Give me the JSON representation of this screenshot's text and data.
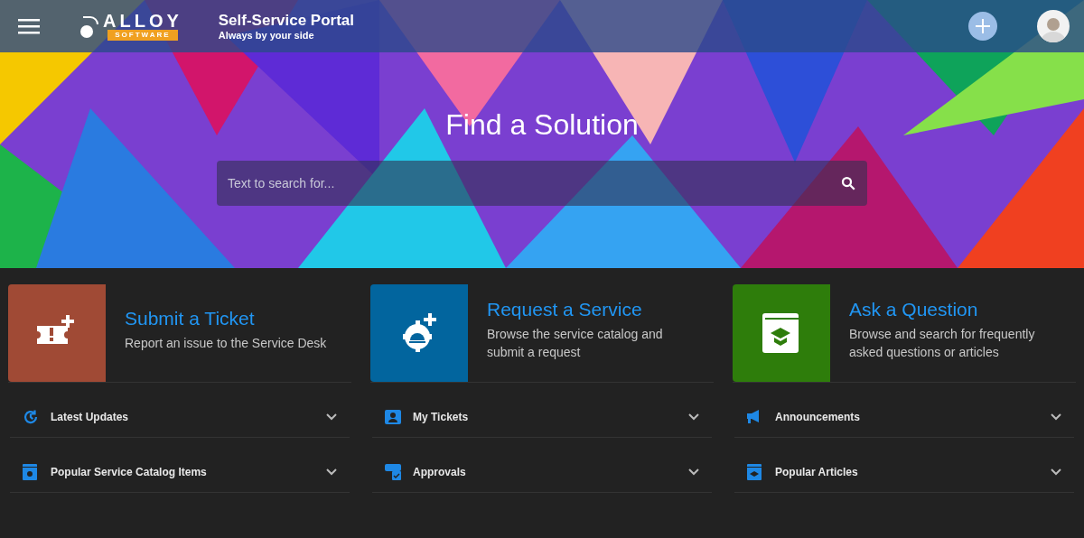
{
  "header": {
    "logo": {
      "word": "ALLOY",
      "subword": "SOFTWARE"
    },
    "title": "Self-Service Portal",
    "subtitle": "Always by your side"
  },
  "hero": {
    "heading": "Find a Solution",
    "search": {
      "placeholder": "Text to search for..."
    }
  },
  "columns": [
    {
      "tile": {
        "title": "Submit a Ticket",
        "description": "Report an issue to the Service Desk",
        "color": "#a04a35"
      },
      "panels": [
        {
          "label": "Latest Updates",
          "expanded": false
        },
        {
          "label": "Popular Service Catalog Items",
          "expanded": false
        }
      ]
    },
    {
      "tile": {
        "title": "Request a Service",
        "description": "Browse the service catalog and submit a request",
        "color": "#02659e"
      },
      "panels": [
        {
          "label": "My Tickets",
          "expanded": false
        },
        {
          "label": "Approvals",
          "expanded": false
        }
      ]
    },
    {
      "tile": {
        "title": "Ask a Question",
        "description": "Browse and search for frequently asked questions or articles",
        "color": "#2e7d0b"
      },
      "panels": [
        {
          "label": "Announcements",
          "expanded": false
        },
        {
          "label": "Popular Articles",
          "expanded": false
        }
      ]
    }
  ]
}
